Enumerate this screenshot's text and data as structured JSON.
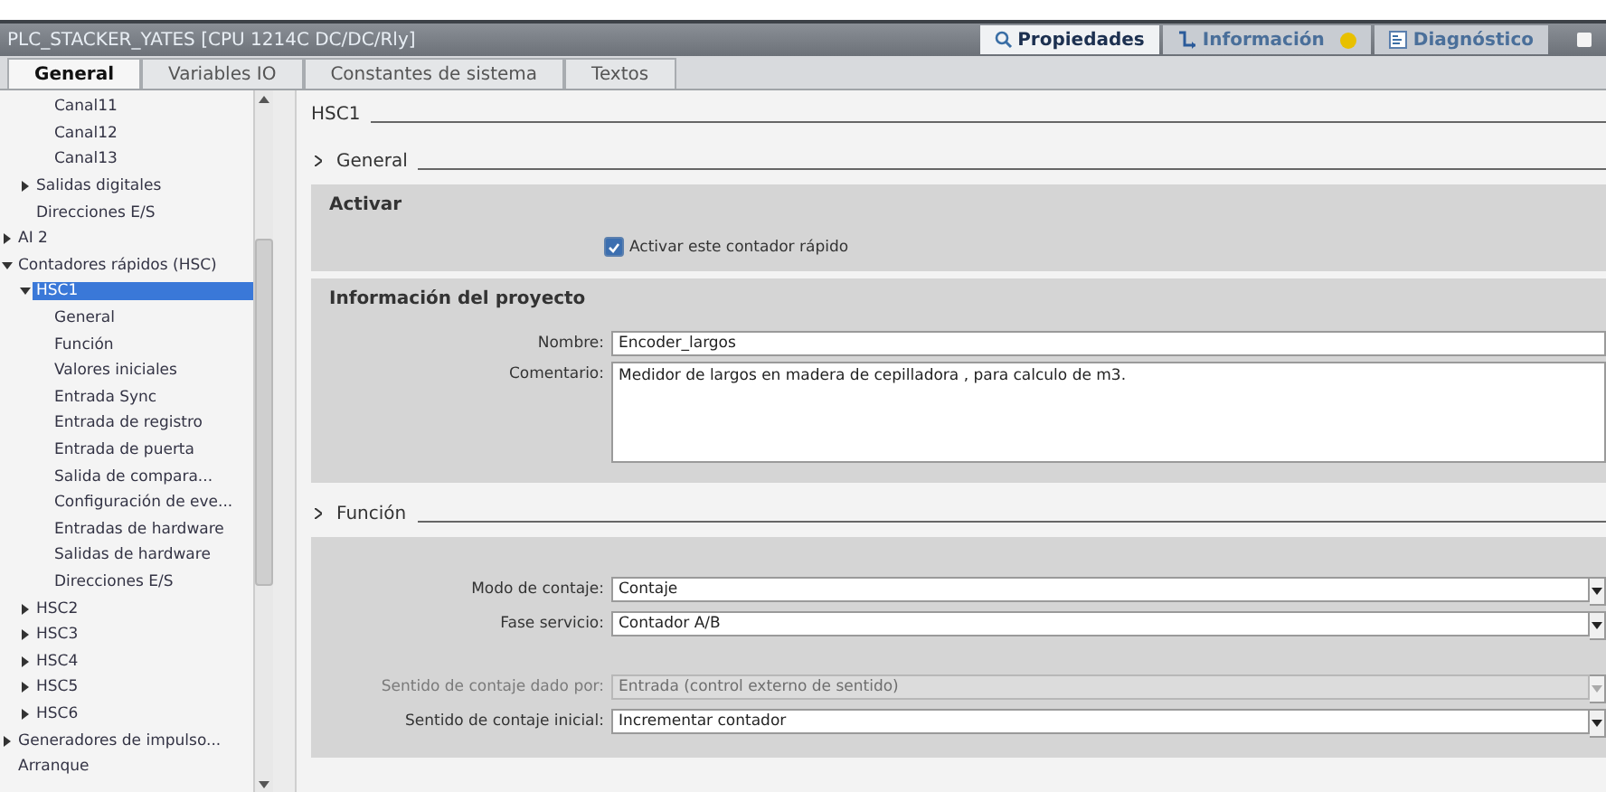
{
  "window": {
    "title": "PLC_STACKER_YATES [CPU 1214C DC/DC/Rly]"
  },
  "inspector_tabs": [
    {
      "label": "Propiedades",
      "selected": true
    },
    {
      "label": "Información",
      "selected": false,
      "badge": true
    },
    {
      "label": "Diagnóstico",
      "selected": false
    }
  ],
  "tabs": [
    {
      "label": "General",
      "selected": true
    },
    {
      "label": "Variables IO",
      "selected": false
    },
    {
      "label": "Constantes de sistema",
      "selected": false
    },
    {
      "label": "Textos",
      "selected": false
    }
  ],
  "tree": {
    "items": [
      {
        "children": [
          {
            "children": [
              {
                "label": "Canal11"
              },
              {
                "label": "Canal12"
              },
              {
                "label": "Canal13"
              }
            ]
          },
          {
            "label": "Salidas digitales",
            "expanded": false
          },
          {
            "label": "Direcciones E/S"
          }
        ]
      },
      {
        "label": "AI 2",
        "expanded": false
      },
      {
        "label": "Contadores rápidos (HSC)",
        "expanded": true,
        "children": [
          {
            "label": "HSC1",
            "expanded": true,
            "selected": true,
            "children": [
              {
                "label": "General"
              },
              {
                "label": "Función"
              },
              {
                "label": "Valores iniciales"
              },
              {
                "label": "Entrada Sync"
              },
              {
                "label": "Entrada de registro"
              },
              {
                "label": "Entrada de puerta"
              },
              {
                "label": "Salida de compara..."
              },
              {
                "label": "Configuración de eve..."
              },
              {
                "label": "Entradas de hardware"
              },
              {
                "label": "Salidas de hardware"
              },
              {
                "label": "Direcciones E/S"
              }
            ]
          },
          {
            "label": "HSC2",
            "expanded": false
          },
          {
            "label": "HSC3",
            "expanded": false
          },
          {
            "label": "HSC4",
            "expanded": false
          },
          {
            "label": "HSC5",
            "expanded": false
          },
          {
            "label": "HSC6",
            "expanded": false
          }
        ]
      },
      {
        "label": "Generadores de impulso...",
        "expanded": false
      },
      {
        "label": "Arranque"
      }
    ]
  },
  "content": {
    "title": "HSC1",
    "sections": [
      {
        "heading": "General",
        "boxes": [
          {
            "title": "Activar",
            "checkbox": {
              "label": "Activar este contador rápido",
              "checked": true
            }
          },
          {
            "title": "Información del proyecto",
            "fields": [
              {
                "kind": "text",
                "label": "Nombre:",
                "value": "Encoder_largos",
                "disabled": false
              },
              {
                "kind": "textarea",
                "label": "Comentario:",
                "value": "Medidor de largos  en madera de cepilladora , para calculo de m3.",
                "disabled": false
              }
            ]
          }
        ]
      },
      {
        "heading": "Función",
        "boxes": [
          {
            "fields": [
              {
                "kind": "select",
                "label": "Modo de contaje:",
                "value": "Contaje",
                "disabled": false
              },
              {
                "kind": "select",
                "label": "Fase servicio:",
                "value": "Contador A/B",
                "disabled": false
              },
              {
                "kind": "gap"
              },
              {
                "kind": "select",
                "label": "Sentido de contaje dado por:",
                "value": "Entrada (control externo de sentido)",
                "disabled": true
              },
              {
                "kind": "select",
                "label": "Sentido de contaje inicial:",
                "value": "Incrementar contador",
                "disabled": false
              }
            ]
          }
        ]
      }
    ]
  }
}
